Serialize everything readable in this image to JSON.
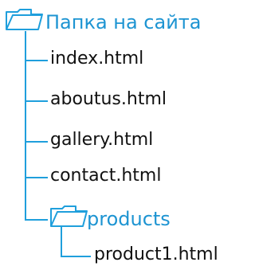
{
  "root": {
    "label": "Папка на сайта",
    "icon": "folder-open-icon",
    "files": [
      {
        "label": "index.html",
        "icon": "file-branch"
      },
      {
        "label": "aboutus.html",
        "icon": "file-branch"
      },
      {
        "label": "gallery.html",
        "icon": "file-branch"
      },
      {
        "label": "contact.html",
        "icon": "file-branch"
      }
    ],
    "subfolder": {
      "label": "products",
      "icon": "folder-open-icon",
      "files": [
        {
          "label": "product1.html",
          "icon": "file-branch"
        }
      ]
    }
  },
  "colors": {
    "accent": "#1d94d2",
    "line": "#1f9fdc",
    "text": "#111111"
  }
}
